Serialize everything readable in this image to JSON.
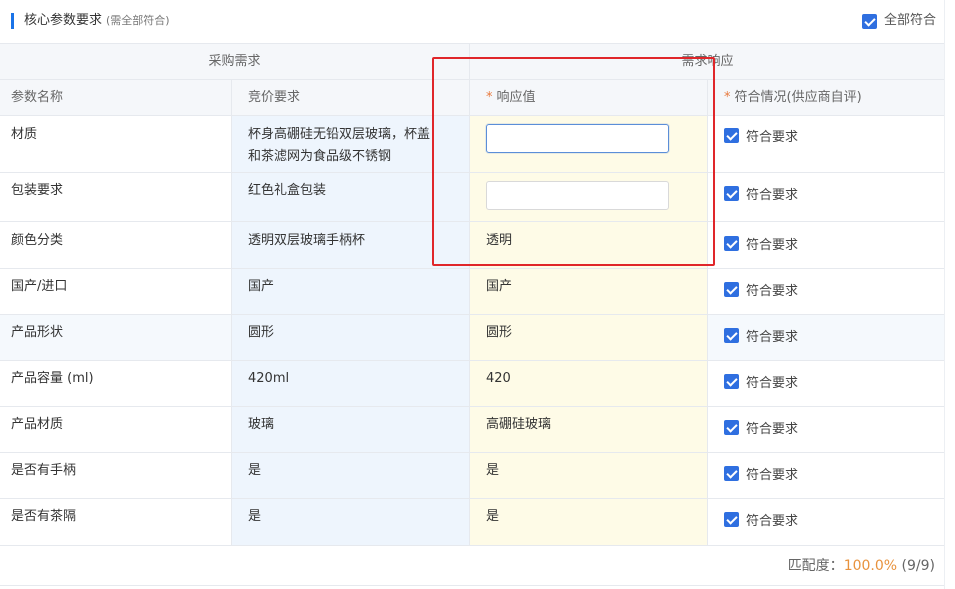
{
  "header": {
    "title": "核心参数要求",
    "subtitle": "(需全部符合)",
    "all_match_label": "全部符合"
  },
  "groups": {
    "procurement": "采购需求",
    "response": "需求响应"
  },
  "columns": {
    "param_name": "参数名称",
    "bid_requirement": "竞价要求",
    "response_value": "响应值",
    "compliance": "符合情况(供应商自评)"
  },
  "rows": [
    {
      "name": "材质",
      "requirement_line1": "杯身高硼硅无铅双层玻璃，杯盖",
      "requirement_line2": "和茶滤网为食品级不锈钢",
      "response": "",
      "compliance": "符合要求"
    },
    {
      "name": "包装要求",
      "requirement": "红色礼盒包装",
      "response": "",
      "compliance": "符合要求"
    },
    {
      "name": "颜色分类",
      "requirement": "透明双层玻璃手柄杯",
      "response": "透明",
      "compliance": "符合要求"
    },
    {
      "name": "国产/进口",
      "requirement": "国产",
      "response": "国产",
      "compliance": "符合要求"
    },
    {
      "name": "产品形状",
      "requirement": "圆形",
      "response": "圆形",
      "compliance": "符合要求"
    },
    {
      "name": "产品容量 (ml)",
      "requirement": "420ml",
      "response": "420",
      "compliance": "符合要求"
    },
    {
      "name": "产品材质",
      "requirement": "玻璃",
      "response": "高硼硅玻璃",
      "compliance": "符合要求"
    },
    {
      "name": "是否有手柄",
      "requirement": "是",
      "response": "是",
      "compliance": "符合要求"
    },
    {
      "name": "是否有茶隔",
      "requirement": "是",
      "response": "是",
      "compliance": "符合要求"
    }
  ],
  "footer": {
    "match_label": "匹配度：",
    "match_percent": "100.0%",
    "match_count": "(9/9)"
  },
  "colors": {
    "accent": "#1a73e8",
    "checkbox": "#2f6fe0",
    "highlight_box": "#e0262a",
    "percent": "#e8923d"
  }
}
